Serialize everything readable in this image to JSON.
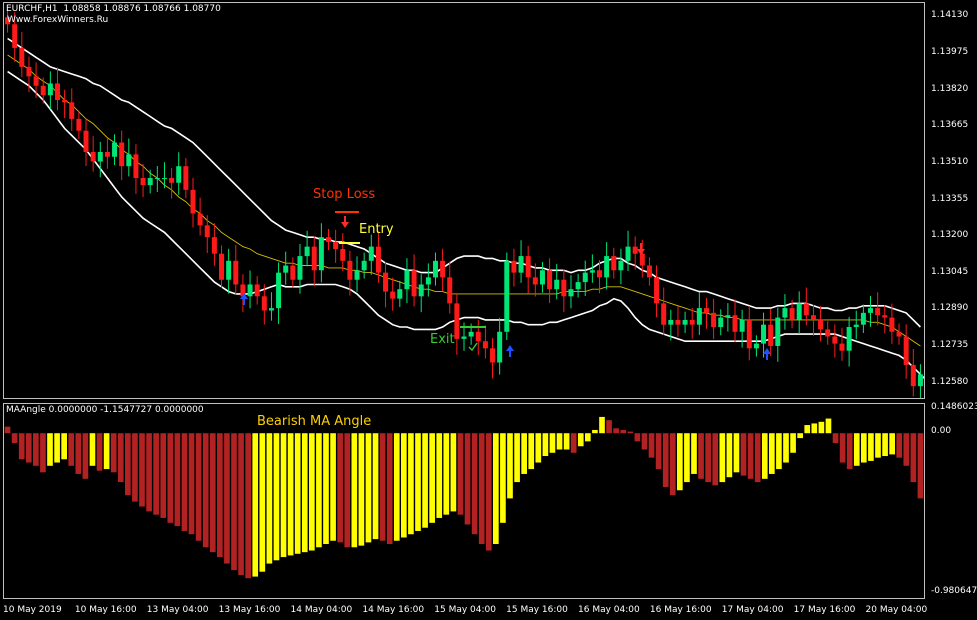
{
  "window": {
    "title": "EURCHF,H1  1.08858 1.08876 1.08766 1.08770",
    "watermark": "Www.ForexWinners.Ru",
    "indicator_title": "MAAngle 0.0000000 -1.1547727 0.0000000"
  },
  "annotations": {
    "stop_loss": "Stop Loss",
    "entry": "Entry",
    "exit": "Exit",
    "bearish": "Bearish MA Angle"
  },
  "colors": {
    "background": "#000000",
    "bull": "#00e676",
    "bear": "#ff1a1a",
    "bands": "#ffffff",
    "ma": "#d4c000",
    "hist_bull": "#ffff00",
    "hist_bear": "#b22222",
    "stop_loss": "#ff3300",
    "entry": "#ffff33",
    "exit": "#33cc33",
    "arrow_up": "#1e50ff",
    "arrow_down": "#ff2a2a"
  },
  "chart_data": [
    {
      "type": "candlestick",
      "symbol": "EURCHF",
      "timeframe": "H1",
      "ylim": [
        1.1252,
        1.1419
      ],
      "y_ticks": [
        "1.14130",
        "1.13975",
        "1.13820",
        "1.13665",
        "1.13510",
        "1.13355",
        "1.13200",
        "1.13045",
        "1.12890",
        "1.12735",
        "1.12580"
      ],
      "x_ticks": [
        "10 May 2019",
        "10 May 16:00",
        "13 May 04:00",
        "13 May 16:00",
        "14 May 04:00",
        "14 May 16:00",
        "15 May 04:00",
        "15 May 16:00",
        "16 May 04:00",
        "16 May 16:00",
        "17 May 04:00",
        "17 May 16:00",
        "20 May 04:00"
      ],
      "close": [
        1.141,
        1.14,
        1.1392,
        1.1388,
        1.1384,
        1.138,
        1.1385,
        1.1378,
        1.1377,
        1.137,
        1.1365,
        1.1356,
        1.1352,
        1.1356,
        1.1354,
        1.136,
        1.135,
        1.1355,
        1.1345,
        1.1342,
        1.1345,
        1.1345,
        1.1345,
        1.1343,
        1.135,
        1.134,
        1.133,
        1.1325,
        1.132,
        1.1313,
        1.1302,
        1.131,
        1.13,
        1.1295,
        1.13,
        1.1295,
        1.1289,
        1.129,
        1.1305,
        1.1308,
        1.1302,
        1.1312,
        1.1316,
        1.1306,
        1.132,
        1.1318,
        1.1315,
        1.131,
        1.1302,
        1.1306,
        1.131,
        1.1316,
        1.1305,
        1.1297,
        1.1294,
        1.1298,
        1.1306,
        1.1295,
        1.13,
        1.1303,
        1.131,
        1.1303,
        1.1292,
        1.1277,
        1.1278,
        1.128,
        1.1276,
        1.1273,
        1.1267,
        1.128,
        1.131,
        1.1305,
        1.1312,
        1.1303,
        1.13,
        1.1306,
        1.1298,
        1.1302,
        1.1295,
        1.1298,
        1.1301,
        1.1305,
        1.1306,
        1.1303,
        1.1312,
        1.1306,
        1.131,
        1.1316,
        1.1313,
        1.1308,
        1.1303,
        1.1292,
        1.1283,
        1.1285,
        1.1283,
        1.1285,
        1.1283,
        1.129,
        1.1288,
        1.1282,
        1.1286,
        1.1287,
        1.128,
        1.1285,
        1.1273,
        1.1275,
        1.1283,
        1.1274,
        1.1286,
        1.129,
        1.1285,
        1.1292,
        1.1287,
        1.1285,
        1.1281,
        1.1278,
        1.1275,
        1.1272,
        1.1282,
        1.1283,
        1.1288,
        1.129,
        1.1287,
        1.1286,
        1.128,
        1.1278,
        1.1266,
        1.1257,
        1.1262
      ],
      "bands_upper": [
        1.1404,
        1.1402,
        1.14,
        1.1398,
        1.1396,
        1.1394,
        1.1392,
        1.1391,
        1.139,
        1.1389,
        1.1388,
        1.1387,
        1.1385,
        1.1384,
        1.1382,
        1.138,
        1.1378,
        1.1377,
        1.1375,
        1.1373,
        1.1371,
        1.1369,
        1.1367,
        1.1366,
        1.1364,
        1.1362,
        1.136,
        1.1357,
        1.1354,
        1.1351,
        1.1348,
        1.1345,
        1.1342,
        1.1339,
        1.1336,
        1.1333,
        1.133,
        1.1327,
        1.1325,
        1.1323,
        1.1322,
        1.1321,
        1.132,
        1.132,
        1.1319,
        1.1319,
        1.1318,
        1.1318,
        1.1317,
        1.1316,
        1.1315,
        1.1313,
        1.1311,
        1.1309,
        1.1308,
        1.1307,
        1.1306,
        1.1306,
        1.1305,
        1.1305,
        1.1305,
        1.1307,
        1.1309,
        1.1311,
        1.1312,
        1.1312,
        1.1312,
        1.1311,
        1.1311,
        1.131,
        1.131,
        1.1309,
        1.1309,
        1.1308,
        1.1307,
        1.1307,
        1.1306,
        1.1306,
        1.1306,
        1.1305,
        1.1306,
        1.1306,
        1.1307,
        1.1309,
        1.131,
        1.1311,
        1.1311,
        1.1309,
        1.1308,
        1.1306,
        1.1305,
        1.1303,
        1.1302,
        1.1301,
        1.13,
        1.1299,
        1.1298,
        1.1297,
        1.1297,
        1.1296,
        1.1295,
        1.1294,
        1.1293,
        1.1292,
        1.1291,
        1.129,
        1.129,
        1.129,
        1.1291,
        1.1291,
        1.1292,
        1.1292,
        1.1292,
        1.1291,
        1.129,
        1.129,
        1.1289,
        1.1289,
        1.129,
        1.129,
        1.1291,
        1.1291,
        1.1291,
        1.1291,
        1.129,
        1.1289,
        1.1288,
        1.1285,
        1.1282
      ],
      "bands_lower": [
        1.139,
        1.1388,
        1.1386,
        1.1384,
        1.1381,
        1.1378,
        1.1374,
        1.137,
        1.1366,
        1.1363,
        1.136,
        1.1357,
        1.1353,
        1.1349,
        1.1345,
        1.1341,
        1.1337,
        1.1334,
        1.1331,
        1.1328,
        1.1326,
        1.1324,
        1.1322,
        1.1319,
        1.1316,
        1.1313,
        1.131,
        1.1307,
        1.1304,
        1.1301,
        1.1299,
        1.1297,
        1.1296,
        1.1296,
        1.1296,
        1.1297,
        1.1298,
        1.1299,
        1.13,
        1.1299,
        1.1299,
        1.1299,
        1.13,
        1.13,
        1.13,
        1.13,
        1.13,
        1.1299,
        1.1298,
        1.1296,
        1.1293,
        1.129,
        1.1287,
        1.1285,
        1.1283,
        1.1282,
        1.1282,
        1.1281,
        1.1281,
        1.1281,
        1.1281,
        1.1282,
        1.1284,
        1.1285,
        1.1286,
        1.1286,
        1.1286,
        1.1285,
        1.1285,
        1.1285,
        1.1285,
        1.1284,
        1.1284,
        1.1283,
        1.1283,
        1.1283,
        1.1284,
        1.1284,
        1.1285,
        1.1286,
        1.1287,
        1.1288,
        1.1289,
        1.1291,
        1.1292,
        1.1294,
        1.1293,
        1.129,
        1.1286,
        1.1283,
        1.1281,
        1.128,
        1.1279,
        1.1278,
        1.1277,
        1.1276,
        1.1276,
        1.1276,
        1.1276,
        1.1276,
        1.1276,
        1.1276,
        1.1276,
        1.1276,
        1.1276,
        1.1276,
        1.1276,
        1.1277,
        1.1278,
        1.1279,
        1.1279,
        1.1279,
        1.1279,
        1.1279,
        1.1279,
        1.1279,
        1.1279,
        1.1278,
        1.1277,
        1.1276,
        1.1275,
        1.1274,
        1.1273,
        1.1272,
        1.1271,
        1.127,
        1.1268,
        1.1265,
        1.1262,
        1.1259,
        1.1256
      ],
      "ma": [
        1.1397,
        1.1395,
        1.1393,
        1.1391,
        1.1388,
        1.1386,
        1.1384,
        1.1381,
        1.1378,
        1.1376,
        1.1373,
        1.137,
        1.1368,
        1.1365,
        1.1362,
        1.136,
        1.1357,
        1.1355,
        1.1352,
        1.135,
        1.1347,
        1.1345,
        1.1342,
        1.134,
        1.1337,
        1.1335,
        1.1332,
        1.133,
        1.1327,
        1.1325,
        1.1322,
        1.132,
        1.1318,
        1.1316,
        1.1315,
        1.1313,
        1.1312,
        1.1311,
        1.131,
        1.1309,
        1.1309,
        1.1308,
        1.1308,
        1.1308,
        1.1308,
        1.1307,
        1.1307,
        1.1307,
        1.1306,
        1.1306,
        1.1305,
        1.1305,
        1.1304,
        1.1303,
        1.1302,
        1.1301,
        1.13,
        1.1299,
        1.1298,
        1.1298,
        1.1297,
        1.1297,
        1.1296,
        1.1296,
        1.1296,
        1.1296,
        1.1296,
        1.1296,
        1.1296,
        1.1296,
        1.1296,
        1.1296,
        1.1296,
        1.1296,
        1.1296,
        1.1296,
        1.1296,
        1.1296,
        1.1297,
        1.1297,
        1.1297,
        1.1297,
        1.1298,
        1.1298,
        1.1299,
        1.1299,
        1.1299,
        1.1298,
        1.1297,
        1.1296,
        1.1295,
        1.1294,
        1.1293,
        1.1292,
        1.1291,
        1.129,
        1.1289,
        1.1288,
        1.1288,
        1.1287,
        1.1287,
        1.1286,
        1.1286,
        1.1285,
        1.1285,
        1.1285,
        1.1285,
        1.1285,
        1.1285,
        1.1285,
        1.1285,
        1.1285,
        1.1285,
        1.1285,
        1.1285,
        1.1285,
        1.1285,
        1.1285,
        1.1285,
        1.1285,
        1.1285,
        1.1284,
        1.1284,
        1.1283,
        1.1282,
        1.128,
        1.1278,
        1.1276,
        1.1274
      ]
    },
    {
      "type": "bar",
      "name": "MAAngle",
      "ylim": [
        -0.9806477,
        0.1486023
      ],
      "y_ticks": [
        "0.1486023",
        "0.00",
        "-0.9806477"
      ],
      "values": [
        0.04,
        -0.06,
        -0.16,
        -0.18,
        -0.2,
        -0.24,
        -0.2,
        -0.18,
        -0.16,
        -0.2,
        -0.25,
        -0.28,
        -0.2,
        -0.23,
        -0.22,
        -0.24,
        -0.3,
        -0.38,
        -0.42,
        -0.45,
        -0.48,
        -0.5,
        -0.52,
        -0.55,
        -0.57,
        -0.6,
        -0.62,
        -0.66,
        -0.7,
        -0.73,
        -0.76,
        -0.8,
        -0.84,
        -0.87,
        -0.89,
        -0.88,
        -0.85,
        -0.8,
        -0.78,
        -0.76,
        -0.75,
        -0.74,
        -0.73,
        -0.72,
        -0.7,
        -0.68,
        -0.66,
        -0.67,
        -0.7,
        -0.7,
        -0.69,
        -0.67,
        -0.65,
        -0.66,
        -0.68,
        -0.66,
        -0.64,
        -0.62,
        -0.6,
        -0.58,
        -0.55,
        -0.52,
        -0.5,
        -0.48,
        -0.5,
        -0.56,
        -0.62,
        -0.68,
        -0.72,
        -0.68,
        -0.55,
        -0.4,
        -0.3,
        -0.25,
        -0.22,
        -0.18,
        -0.14,
        -0.12,
        -0.1,
        -0.1,
        -0.12,
        -0.08,
        -0.05,
        0.02,
        0.1,
        0.08,
        0.03,
        0.02,
        0.01,
        -0.05,
        -0.1,
        -0.15,
        -0.22,
        -0.33,
        -0.38,
        -0.35,
        -0.3,
        -0.25,
        -0.28,
        -0.3,
        -0.32,
        -0.3,
        -0.27,
        -0.24,
        -0.26,
        -0.28,
        -0.3,
        -0.28,
        -0.25,
        -0.22,
        -0.18,
        -0.12,
        -0.03,
        0.05,
        0.06,
        0.07,
        0.09,
        -0.06,
        -0.18,
        -0.22,
        -0.2,
        -0.18,
        -0.17,
        -0.15,
        -0.14,
        -0.13,
        -0.15,
        -0.2,
        -0.3,
        -0.4
      ],
      "bar_colors_rule": "yellow when value rises vs previous, dark red when falling"
    }
  ]
}
